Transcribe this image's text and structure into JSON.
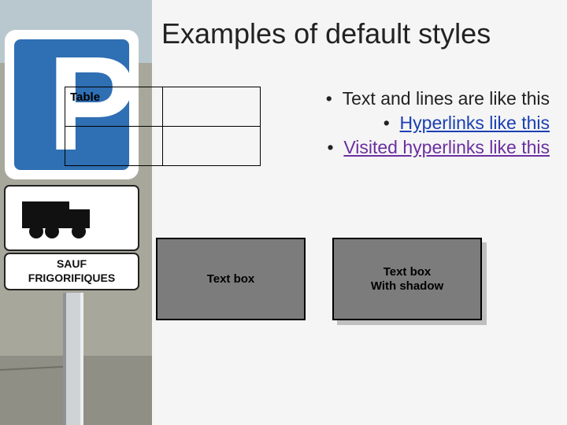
{
  "title": "Examples of default styles",
  "table": {
    "header_cell": "Table"
  },
  "bullets": {
    "line1": "Text and lines are like this",
    "line2": "Hyperlinks like this",
    "line3": "Visited hyperlinks like this"
  },
  "textbox1": "Text box",
  "textbox2_line1": "Text box",
  "textbox2_line2": "With shadow"
}
